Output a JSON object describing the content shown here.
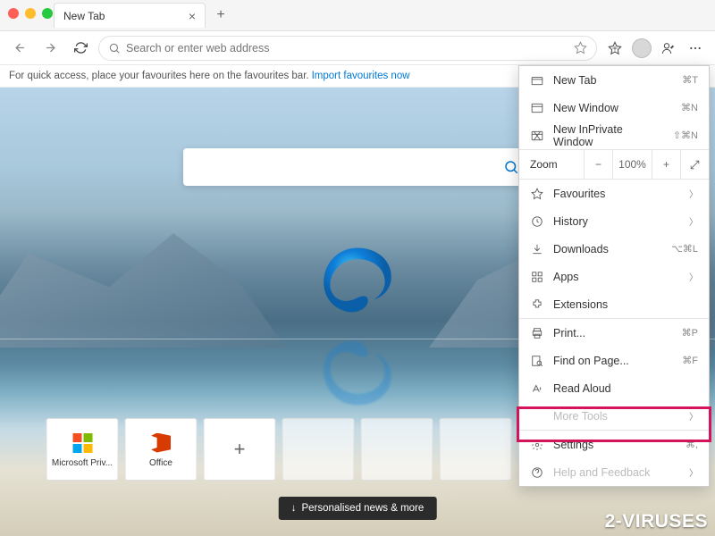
{
  "tab": {
    "title": "New Tab"
  },
  "toolbar": {
    "address_placeholder": "Search or enter web address"
  },
  "favbar": {
    "text": "For quick access, place your favourites here on the favourites bar.",
    "link": "Import favourites now"
  },
  "tiles": [
    {
      "label": "Microsoft Priv...",
      "icon": "microsoft"
    },
    {
      "label": "Office",
      "icon": "office"
    },
    {
      "label": "",
      "icon": "plus"
    },
    {
      "label": "",
      "icon": ""
    },
    {
      "label": "",
      "icon": ""
    },
    {
      "label": "",
      "icon": ""
    },
    {
      "label": "",
      "icon": ""
    },
    {
      "label": "",
      "icon": ""
    }
  ],
  "news_button": "Personalised news & more",
  "menu": {
    "new_tab": "New Tab",
    "new_tab_sc": "⌘T",
    "new_window": "New Window",
    "new_window_sc": "⌘N",
    "new_inprivate": "New InPrivate Window",
    "new_inprivate_sc": "⇧⌘N",
    "zoom": "Zoom",
    "zoom_val": "100%",
    "favourites": "Favourites",
    "history": "History",
    "downloads": "Downloads",
    "downloads_sc": "⌥⌘L",
    "apps": "Apps",
    "extensions": "Extensions",
    "print": "Print...",
    "print_sc": "⌘P",
    "find": "Find on Page...",
    "find_sc": "⌘F",
    "read_aloud": "Read Aloud",
    "more_tools": "More Tools",
    "settings": "Settings",
    "settings_sc": "⌘,",
    "help": "Help and Feedback"
  },
  "watermark": "2-VIRUSES"
}
